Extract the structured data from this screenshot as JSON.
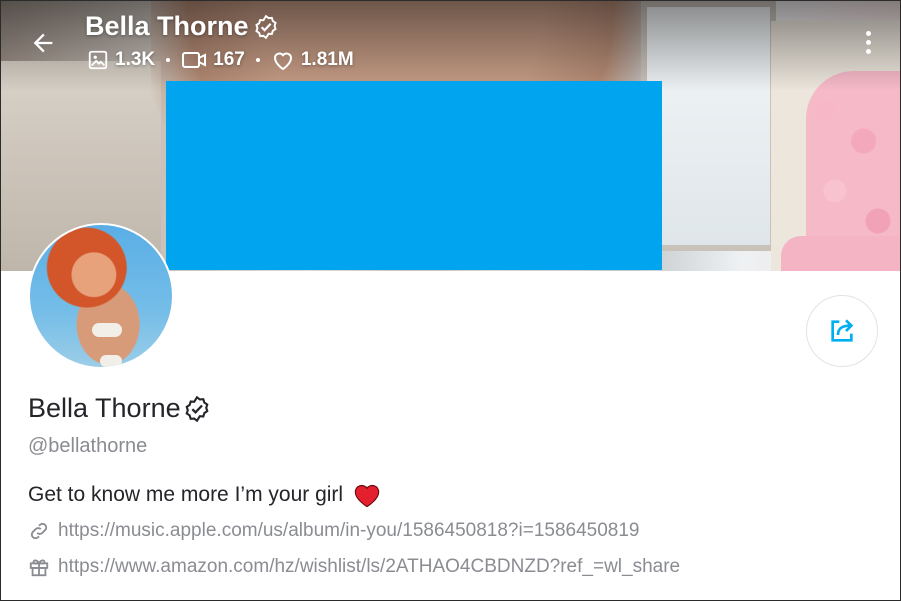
{
  "header": {
    "name": "Bella Thorne",
    "stats": {
      "photos": "1.3K",
      "videos": "167",
      "likes": "1.81M"
    }
  },
  "profile": {
    "name": "Bella Thorne",
    "handle": "@bellathorne",
    "bio": "Get to know me more I’m your girl",
    "links": [
      {
        "icon": "link-icon",
        "text": "https://music.apple.com/us/album/in-you/1586450818?i=1586450819"
      },
      {
        "icon": "gift-icon",
        "text": "https://www.amazon.com/hz/wishlist/ls/2ATHAO4CBDNZD?ref_=wl_share"
      }
    ]
  },
  "icons": {
    "back": "arrow-left-icon",
    "verified": "verified-badge-icon",
    "photos": "image-icon",
    "videos": "video-icon",
    "likes": "heart-icon",
    "more": "more-vertical-icon",
    "share": "share-icon",
    "bio_emoji": "red-heart-icon"
  },
  "colors": {
    "accent": "#00aff0",
    "redaction": "#00a4ef",
    "muted_text": "#8a8c92",
    "text": "#242529"
  }
}
